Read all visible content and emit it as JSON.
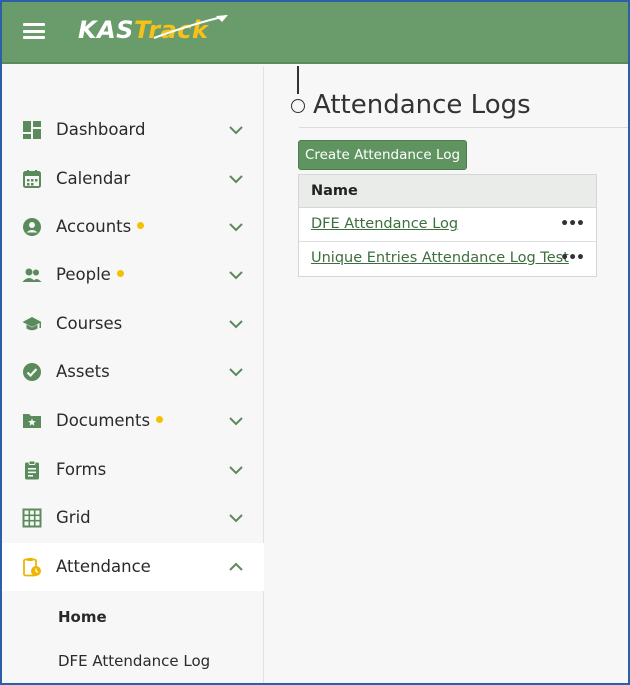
{
  "header": {
    "logo_kas": "KAS",
    "logo_track": "Track",
    "menu_icon": "hamburger-menu-icon",
    "colors": {
      "bar": "#6a9b6b",
      "accent": "#f6c21a"
    }
  },
  "sidebar": {
    "items": [
      {
        "label": "Dashboard",
        "icon": "dashboard-icon",
        "dot": false
      },
      {
        "label": "Calendar",
        "icon": "calendar-icon",
        "dot": false
      },
      {
        "label": "Accounts",
        "icon": "account-circle-icon",
        "dot": true
      },
      {
        "label": "People",
        "icon": "people-icon",
        "dot": true
      },
      {
        "label": "Courses",
        "icon": "graduation-cap-icon",
        "dot": false
      },
      {
        "label": "Assets",
        "icon": "check-circle-icon",
        "dot": false
      },
      {
        "label": "Documents",
        "icon": "folder-star-icon",
        "dot": true
      },
      {
        "label": "Forms",
        "icon": "clipboard-icon",
        "dot": false
      },
      {
        "label": "Grid",
        "icon": "grid-icon",
        "dot": false
      },
      {
        "label": "Attendance",
        "icon": "clipboard-clock-icon",
        "dot": false,
        "expanded": true
      }
    ],
    "sub_items": [
      {
        "label": "Home",
        "bold": true
      },
      {
        "label": "DFE Attendance Log",
        "bold": false
      }
    ]
  },
  "main": {
    "title": "Attendance Logs",
    "create_button": "Create Attendance Log",
    "table": {
      "column": "Name",
      "rows": [
        {
          "name": "DFE Attendance Log",
          "more": "•••"
        },
        {
          "name": "Unique Entries Attendance Log Test",
          "more": "•••"
        }
      ]
    }
  }
}
